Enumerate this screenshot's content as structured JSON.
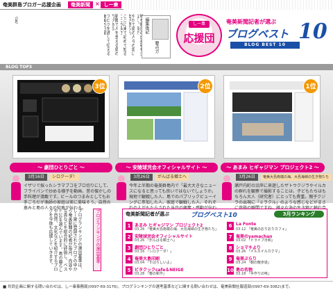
{
  "header": {
    "title": "奄美群島ブロガー応援企画",
    "tag1": "奄美新聞",
    "sep": "×",
    "tag2": "しー衆"
  },
  "article": {
    "columns": [
      "時を明日の出来事も少なく、皆で",
      "やがて島の人々の思い出が語られ",
      "ここに来て初めて知ることの多さ",
      "新聞で人を支える島の力がある",
      "ブログを通して伝える奄美の日常",
      "（記）"
    ],
    "note_label": "編集後記",
    "note_name": "要点ガ"
  },
  "badge": {
    "crown": "しー衆",
    "text": "応援団"
  },
  "title_block": {
    "line1": "奄美新聞記者が選ぶ",
    "line2": "ブログベスト",
    "num": "10",
    "sub": "BLOG BEST 10"
  },
  "band": {
    "label": "BLOG TOP3"
  },
  "top3": [
    {
      "rank": "3位",
      "title": "〜 劇団ひとりごと 〜",
      "date": "3月16日",
      "name": "シロクーダ！",
      "desc": "イザリで採ったシラマブコをブロ切りにして、フライパンで炒める様子を動画、昔の懐かしの手料理が満載です。ビールのつまみとしてもお手ごろだが漁師の家庭は実に美味そう。自然の恵みと島の人々の知恵が伝わる。"
    },
    {
      "rank": "2位",
      "title": "〜 安陵球児会オフィシャルサイト 〜",
      "date": "3月26日",
      "name": "がんばる郷土へ",
      "desc": "今年上半期の奄美群島内で「最大大きなニュースになると思っても良いではないでしょうか。現地で観戦した人、島でのパブリックビューイングに参加した人、家庭で観戦した人、それぞれの人がもたらされた当日の興奮・感動が伝わってくるのです。"
    },
    {
      "rank": "1位",
      "title": "〜 あまみ ヒギャジマン プロジェクト2 〜",
      "date": "3月26日",
      "name": "奄美大島南端の海、大島海峡の生き物たち",
      "desc": "瀬戸内町の沿岸に来遊したザトウクジラやイルカの群れを観察で撮影することは、子どもたちはもちろん大人（研究者）にとっても貴重。親子クジラの出現に「ミラクル」のような感じなどがまさに奇跡の瞬間ですね。様々な海の生き物と触れ合いのことがこれまでになく伝わってきた。"
    }
  ],
  "bottom": {
    "text": "ブログランキングの選出基準は、しー衆に登録されたブログの中から奄美新聞の記者が毎月、内容や写真などを総合的に評価し、ベスト10を選んでいます。島の暮らしや自然、文化などを紹介するブログを今後も応援していきます。",
    "side": "ブログランキングの選出基準"
  },
  "ranking": {
    "lead": "奄美新聞記者が選ぶ",
    "title": "ブログベスト10",
    "badge": "3月ランキング",
    "items": [
      {
        "num": "1",
        "name": "あまみ ヒギャジマン プロジェクト2",
        "sub": "03.26 「奄美大島南端の海、大島海峡の生き物たち」"
      },
      {
        "num": "2",
        "name": "安陵球児会オフィシャルサイト",
        "sub": "03.26 「がんばる郷土へ」"
      },
      {
        "num": "3",
        "name": "劇団ひとりごと",
        "sub": "03.16 「シロクーダ！」"
      },
      {
        "num": "4",
        "name": "奄美大島印刷",
        "sub": "03.04 「すばらしいよ」"
      },
      {
        "num": "5",
        "name": "ビタクックcafe＆NEIGE",
        "sub": "03.28 「春の新作」"
      },
      {
        "num": "6",
        "name": "La Fonte",
        "sub": "03.12 「奄美のおりおりカフェ」"
      },
      {
        "num": "7",
        "name": "奄美のyamachan",
        "sub": "03.02 「ドライブ日和」"
      },
      {
        "num": "8",
        "name": "ショマキより",
        "sub": "03.26 「イルカイルカクマ」"
      },
      {
        "num": "9",
        "name": "奄美ぶらり",
        "sub": "03.24 「朝の散歩道」"
      },
      {
        "num": "10",
        "name": "島の名物",
        "sub": "03.18 「手作りの味」"
      }
    ]
  },
  "footer": {
    "text": "■ 共同企画に関する問い合わせは、しー衆事務局(0997-69-3176)、ブログランキングの選考基準などに関する問い合わせは、奄美新聞社報道部(0997-69-3082)まで。"
  }
}
